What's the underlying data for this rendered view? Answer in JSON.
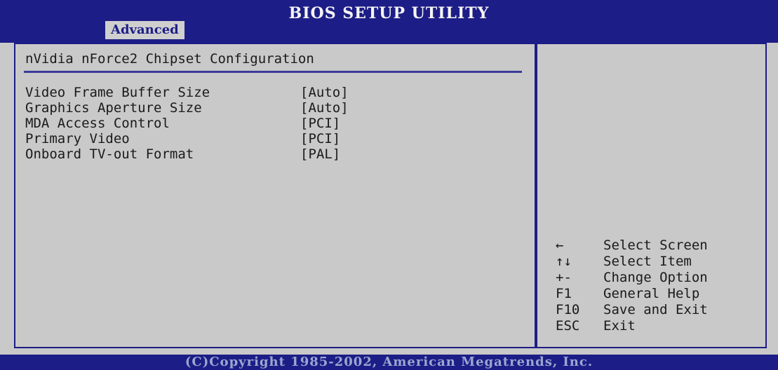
{
  "header": {
    "title": "BIOS SETUP UTILITY",
    "active_tab": "Advanced"
  },
  "main": {
    "section_title": "nVidia nForce2 Chipset Configuration",
    "settings": [
      {
        "label": "Video Frame Buffer Size",
        "value": "[Auto]"
      },
      {
        "label": "Graphics Aperture Size",
        "value": "[Auto]"
      },
      {
        "label": "MDA Access Control",
        "value": "[PCI]"
      },
      {
        "label": "Primary Video",
        "value": "[PCI]"
      },
      {
        "label": "Onboard TV-out Format",
        "value": "[PAL]"
      }
    ]
  },
  "help": {
    "keys": [
      {
        "key": "←",
        "action": "Select Screen"
      },
      {
        "key": "↑↓",
        "action": "Select Item"
      },
      {
        "key": "+-",
        "action": "Change Option"
      },
      {
        "key": "F1",
        "action": "General Help"
      },
      {
        "key": "F10",
        "action": "Save and Exit"
      },
      {
        "key": "ESC",
        "action": "Exit"
      }
    ]
  },
  "footer": {
    "copyright": "(C)Copyright 1985-2002, American Megatrends, Inc."
  },
  "colors": {
    "bar": "#1d1d87",
    "panel": "#c9c9c9"
  }
}
